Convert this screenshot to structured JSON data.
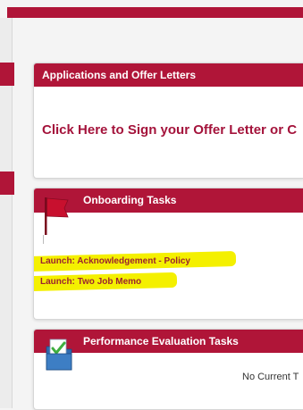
{
  "applications_panel": {
    "title": "Applications and Offer Letters",
    "sign_link": "Click Here to Sign your Offer Letter or C"
  },
  "onboarding_panel": {
    "title": "Onboarding Tasks",
    "icon": "red-flag-icon",
    "tasks": [
      {
        "label": "Launch: Acknowledgement - Policy"
      },
      {
        "label": "Launch: Two Job Memo"
      }
    ]
  },
  "performance_panel": {
    "title": "Performance Evaluation Tasks",
    "icon": "folder-checkmark-icon",
    "empty_text": "No Current T"
  },
  "colors": {
    "brand_red": "#b01538",
    "link_red": "#a4133b",
    "highlight_yellow": "#f4f000"
  }
}
